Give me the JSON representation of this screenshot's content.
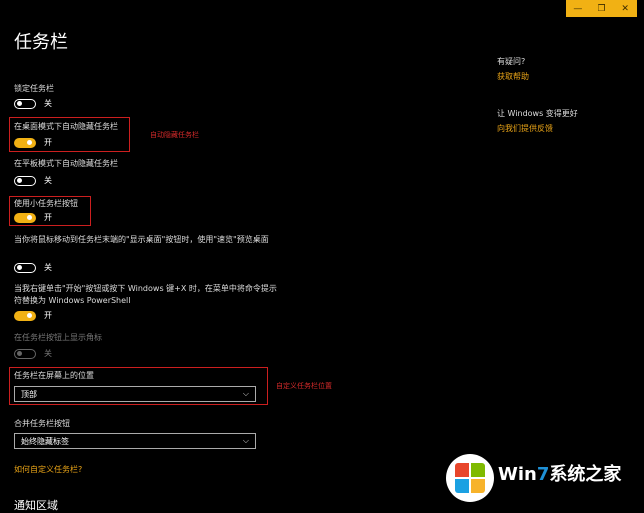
{
  "window": {
    "controls": {
      "minimize": "—",
      "maximize": "❐",
      "close": "✕"
    }
  },
  "page": {
    "title": "任务栏"
  },
  "settings": {
    "lock_taskbar": {
      "label": "锁定任务栏",
      "state": "关"
    },
    "auto_hide_desktop": {
      "label": "在桌面模式下自动隐藏任务栏",
      "state": "开",
      "annotation": "自动隐藏任务栏"
    },
    "auto_hide_tablet": {
      "label": "在平板模式下自动隐藏任务栏",
      "state": "关"
    },
    "small_buttons": {
      "label": "使用小任务栏按钮",
      "state": "开"
    },
    "peek": {
      "label": "当你将鼠标移动到任务栏末端的\"显示桌面\"按钮时，使用\"速览\"预览桌面",
      "state": "关"
    },
    "powershell": {
      "label": "当我右键单击\"开始\"按钮或按下 Windows 键+X 时，在菜单中将命令提示符替换为 Windows PowerShell",
      "state": "开"
    },
    "badges": {
      "label": "在任务栏按钮上显示角标",
      "state": "关"
    },
    "location": {
      "label": "任务栏在屏幕上的位置",
      "value": "顶部",
      "annotation": "自定义任务栏位置"
    },
    "combine": {
      "label": "合并任务栏按钮",
      "value": "始终隐藏标签"
    }
  },
  "customize_link": "如何自定义任务栏?",
  "next_section": "通知区域",
  "help": {
    "heading": "有疑问?",
    "link": "获取帮助",
    "improve_heading": "让 Windows 变得更好",
    "improve_link": "向我们提供反馈"
  },
  "watermark": {
    "prefix": "Win",
    "seven": "7",
    "suffix": "系统之家"
  },
  "colors": {
    "accent": "#f1b114",
    "highlight": "#cc1f1f",
    "link": "#e8a317"
  }
}
